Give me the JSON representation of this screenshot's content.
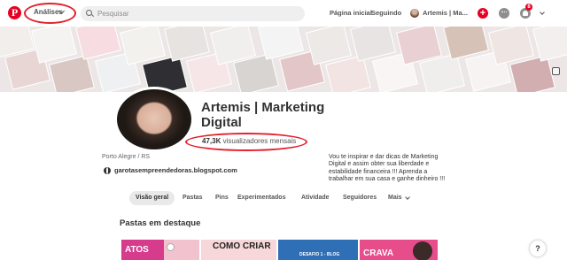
{
  "header": {
    "logo": "P",
    "analytics_label": "Análises",
    "search": {
      "placeholder": "Pesquisar",
      "value": ""
    },
    "home_label": "Página inicial",
    "following_label": "Seguindo",
    "user_label": "Artemis | Ma...",
    "plus_label": "+",
    "notification_count": "8"
  },
  "profile": {
    "name": "Artemis | Marketing Digital",
    "monthly_viewers_value": "47,3K",
    "monthly_viewers_label": "visualizadores mensais",
    "location": "Porto Alegre / RS",
    "website": "garotasempreendedoras.blogspot.com",
    "bio": "Vou te inspirar e dar dicas de Marketing Digital e assim obter sua liberdade e estabilidade financeira !!! Aprenda a trabalhar em sua casa e ganhe dinheiro !!!"
  },
  "tabs": [
    {
      "label": "Visão geral",
      "active": true
    },
    {
      "label": "Pastas"
    },
    {
      "label": "Pins"
    },
    {
      "label": "Experimentados"
    },
    {
      "label": "Atividade"
    },
    {
      "label": "Seguidores"
    },
    {
      "label": "Mais"
    }
  ],
  "featured": {
    "title": "Pastas em destaque",
    "boards": [
      {
        "text": "ATOS",
        "bg": "#d63b8c",
        "fg": "#ffffff"
      },
      {
        "text": "",
        "bg": "#f2c2cf",
        "fg": "#333333"
      },
      {
        "text": "COMO CRIAR",
        "bg": "#f7d7d9",
        "fg": "#222222"
      },
      {
        "text": "DESAFIO 1 - BLOG",
        "bg": "#2f6fb6",
        "fg": "#ffffff"
      },
      {
        "text": "CRAVA",
        "bg": "#e74c8b",
        "fg": "#ffffff"
      }
    ]
  },
  "help_label": "?",
  "colors": {
    "brand_red": "#e60023",
    "annotation_red": "#e3202c"
  }
}
